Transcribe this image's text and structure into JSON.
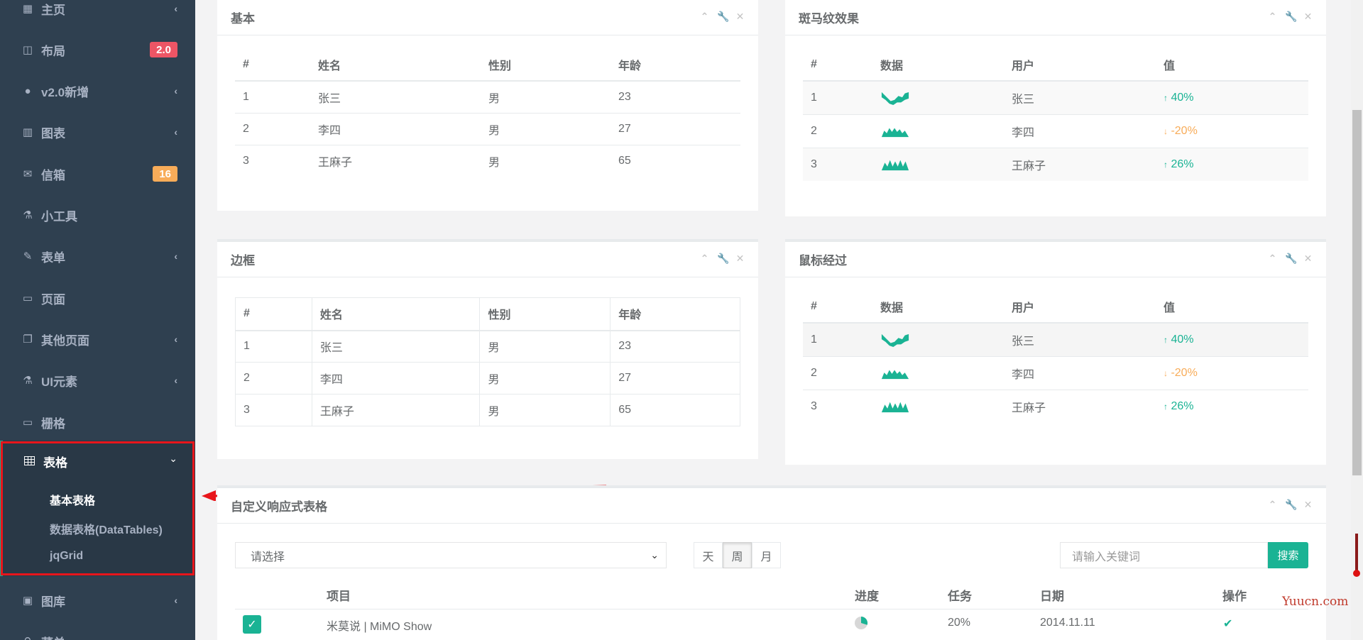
{
  "sidebar": {
    "items": [
      {
        "label": "主页",
        "icon": "grid-icon",
        "arrow": "‹"
      },
      {
        "label": "布局",
        "icon": "columns-icon",
        "badge": "2.0",
        "badge_color": "#ed5565"
      },
      {
        "label": "v2.0新增",
        "icon": "globe-icon",
        "arrow": "‹"
      },
      {
        "label": "图表",
        "icon": "bar-chart-icon",
        "arrow": "‹"
      },
      {
        "label": "信箱",
        "icon": "envelope-icon",
        "badge": "16",
        "badge_color": "#f8ac59"
      },
      {
        "label": "小工具",
        "icon": "flask-icon"
      },
      {
        "label": "表单",
        "icon": "edit-icon",
        "arrow": "‹"
      },
      {
        "label": "页面",
        "icon": "desktop-icon"
      },
      {
        "label": "其他页面",
        "icon": "files-icon",
        "arrow": "‹"
      },
      {
        "label": "UI元素",
        "icon": "flask-icon",
        "arrow": "‹"
      },
      {
        "label": "栅格",
        "icon": "laptop-icon"
      }
    ],
    "active": {
      "label": "表格",
      "icon": "table-icon",
      "arrow": "⌄",
      "subitems": [
        "基本表格",
        "数据表格(DataTables)",
        "jqGrid"
      ]
    },
    "after": [
      {
        "label": "图库",
        "icon": "picture-icon",
        "arrow": "‹"
      },
      {
        "label": "菜单",
        "icon": "sitemap-icon"
      }
    ]
  },
  "tools": {
    "collapse": "⌃",
    "config": "🔧",
    "close": "✕"
  },
  "basic": {
    "title": "基本",
    "headers": [
      "#",
      "姓名",
      "性别",
      "年龄"
    ],
    "rows": [
      [
        "1",
        "张三",
        "男",
        "23"
      ],
      [
        "2",
        "李四",
        "男",
        "27"
      ],
      [
        "3",
        "王麻子",
        "男",
        "65"
      ]
    ]
  },
  "striped": {
    "title": "斑马纹效果",
    "headers": [
      "#",
      "数据",
      "用户",
      "值"
    ],
    "rows": [
      {
        "n": "1",
        "user": "张三",
        "value": "40%",
        "dir": "up",
        "spark": "wave"
      },
      {
        "n": "2",
        "user": "李四",
        "value": "-20%",
        "dir": "down",
        "spark": "hills"
      },
      {
        "n": "3",
        "user": "王麻子",
        "value": "26%",
        "dir": "up",
        "spark": "peaks"
      }
    ]
  },
  "bordered": {
    "title": "边框",
    "headers": [
      "#",
      "姓名",
      "性别",
      "年龄"
    ],
    "rows": [
      [
        "1",
        "张三",
        "男",
        "23"
      ],
      [
        "2",
        "李四",
        "男",
        "27"
      ],
      [
        "3",
        "王麻子",
        "男",
        "65"
      ]
    ]
  },
  "hover": {
    "title": "鼠标经过",
    "headers": [
      "#",
      "数据",
      "用户",
      "值"
    ],
    "rows": [
      {
        "n": "1",
        "user": "张三",
        "value": "40%",
        "dir": "up",
        "spark": "wave"
      },
      {
        "n": "2",
        "user": "李四",
        "value": "-20%",
        "dir": "down",
        "spark": "hills"
      },
      {
        "n": "3",
        "user": "王麻子",
        "value": "26%",
        "dir": "up",
        "spark": "peaks"
      }
    ]
  },
  "custom": {
    "title": "自定义响应式表格",
    "select_value": "请选择",
    "segments": [
      "天",
      "周",
      "月"
    ],
    "active_segment": "周",
    "search_placeholder": "请输入关键词",
    "search_button": "搜索",
    "headers": [
      "项目",
      "进度",
      "任务",
      "日期",
      "操作"
    ],
    "row": {
      "project": "米莫说 | MiMO Show",
      "task": "20%",
      "date": "2014.11.11",
      "checked": true
    }
  },
  "watermark": "Yuucn.com",
  "colors": {
    "sidebar": "#2f4050",
    "accent": "#1ab394",
    "danger": "#ed5565",
    "warning": "#f8ac59",
    "highlight_outline": "#e8151b"
  }
}
